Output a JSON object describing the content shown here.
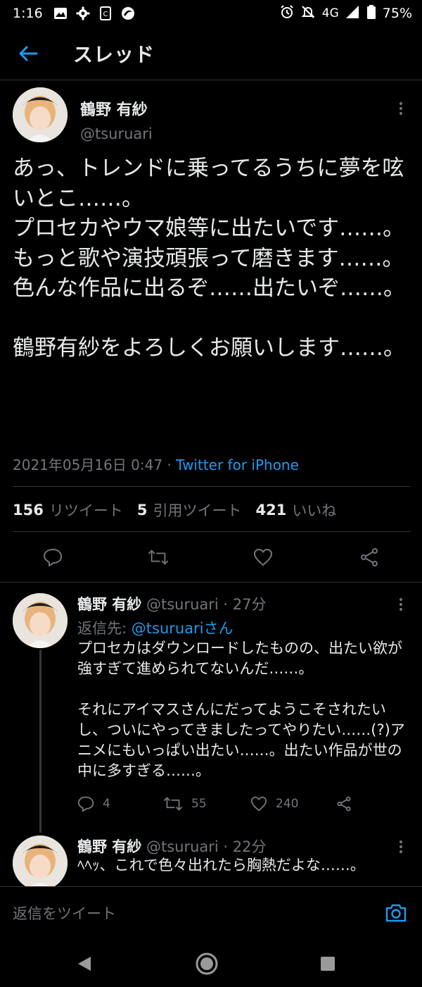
{
  "status_bar": {
    "time": "1:16",
    "network": "4G",
    "battery": "75%",
    "left_icons": [
      "image-icon",
      "gear-icon",
      "sim-icon",
      "app-icon"
    ],
    "right_icons": [
      "alarm-icon",
      "mute-icon",
      "signal-icon",
      "battery-icon"
    ]
  },
  "header": {
    "title": "スレッド",
    "back_icon": "arrow-left-icon"
  },
  "main_tweet": {
    "author_name": "鶴野 有紗",
    "author_handle": "@tsuruari",
    "text": "あっ、トレンドに乗ってるうちに夢を呟いとこ……。\nプロセカやウマ娘等に出たいです……。\nもっと歌や演技頑張って磨きます……。\n色んな作品に出るぞ……出たいぞ……。\n\n鶴野有紗をよろしくお願いします……。",
    "timestamp": "2021年05月16日 0:47",
    "separator": " · ",
    "source": "Twitter for iPhone",
    "stats": [
      {
        "count": "156",
        "label": "リツイート"
      },
      {
        "count": "5",
        "label": "引用ツイート"
      },
      {
        "count": "421",
        "label": "いいね"
      }
    ]
  },
  "replies": [
    {
      "author_name": "鶴野 有紗",
      "handle_time": " @tsuruari · 27分",
      "reply_to_label": "返信先: ",
      "reply_to_mention": "@tsuruariさん",
      "text": "プロセカはダウンロードしたものの、出たい欲が強すぎて進められてないんだ……。\n\nそれにアイマスさんにだってようこそされたいし、ついにやってきましたってやりたい……(?)アニメにもいっぱい出たい……。出たい作品が世の中に多すぎる……。",
      "reply_count": "4",
      "retweet_count": "55",
      "like_count": "240"
    },
    {
      "author_name": "鶴野 有紗",
      "handle_time": " @tsuruari · 22分",
      "text": "ﾍﾍｯ、これで色々出れたら胸熱だよな……。"
    }
  ],
  "reply_bar": {
    "placeholder": "返信をツイート"
  },
  "colors": {
    "background": "#000000",
    "text": "#e7e9ea",
    "secondary": "#71767b",
    "accent": "#1d9bf0",
    "divider": "#2f3336"
  }
}
